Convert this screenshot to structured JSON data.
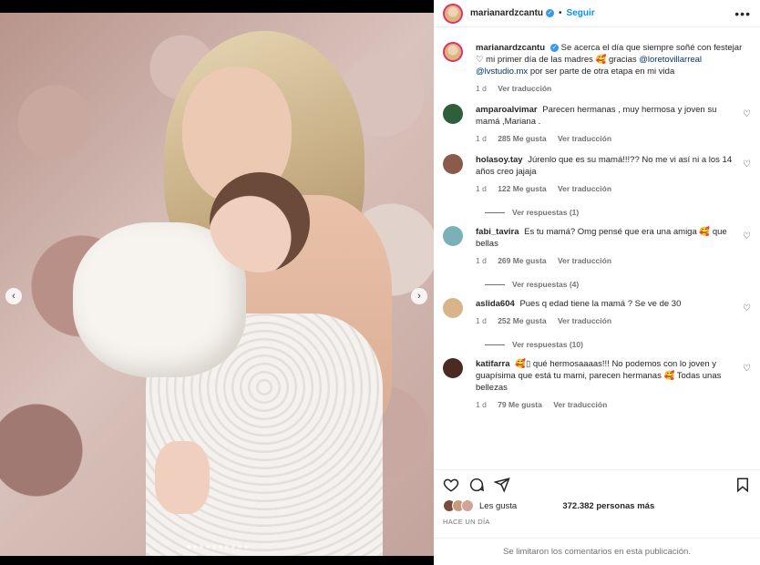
{
  "post": {
    "username": "marianardzcantu",
    "follow_label": "Seguir",
    "more_label": "•••",
    "caption_pre": "Se acerca el día que siempre soñé con festejar ♡ mi primer día de las madres 🥰 gracias",
    "mention1": "@loretovillarreal",
    "mention2": "@lvstudio.mx",
    "caption_post": "por ser parte de otra etapa en mi vida",
    "age": "1 d",
    "translate": "Ver traducción"
  },
  "comments": [
    {
      "user": "amparoalvimar",
      "text": "Parecen hermanas , muy hermosa y joven su mamá ,Mariana .",
      "age": "1 d",
      "likes": "285 Me gusta",
      "translate": "Ver traducción",
      "replies": ""
    },
    {
      "user": "holasoy.tay",
      "text": "Júrenlo que es su mamá!!!?? No me vi así ni a los 14 años creo jajaja",
      "age": "1 d",
      "likes": "122 Me gusta",
      "translate": "Ver traducción",
      "replies": "Ver respuestas (1)"
    },
    {
      "user": "fabi_tavira",
      "text": "Es tu mamá? Omg pensé que era una amiga 🥰 que bellas",
      "age": "1 d",
      "likes": "269 Me gusta",
      "translate": "Ver traducción",
      "replies": "Ver respuestas (4)"
    },
    {
      "user": "aslida604",
      "text": "Pues q edad tiene la mamá ? Se ve de 30",
      "age": "1 d",
      "likes": "252 Me gusta",
      "translate": "Ver traducción",
      "replies": "Ver respuestas (10)"
    },
    {
      "user": "katifarra",
      "text": "🥰▯ qué hermosaaaas!!! No podemos con lo joven y guapísima que está tu mami, parecen hermanas 🥰 Todas unas bellezas",
      "age": "1 d",
      "likes": "79 Me gusta",
      "translate": "Ver traducción",
      "replies": ""
    }
  ],
  "likes_prefix": "Les gusta",
  "likes_count": "372.382 personas más",
  "posted_ago": "HACE UN DÍA",
  "comments_limited": "Se limitaron los comentarios en esta publicación.",
  "carousel": {
    "prev": "‹",
    "next": "›",
    "slides": 10,
    "active": 0
  },
  "colors": {
    "link": "#0095f6",
    "mention": "#00376b",
    "muted": "#737373",
    "story_ring": "#e1306c",
    "verified": "#3897f0"
  },
  "icons": [
    "heart-icon",
    "comment-icon",
    "share-icon",
    "bookmark-icon",
    "verified-icon",
    "more-icon",
    "chevron-left-icon",
    "chevron-right-icon"
  ]
}
